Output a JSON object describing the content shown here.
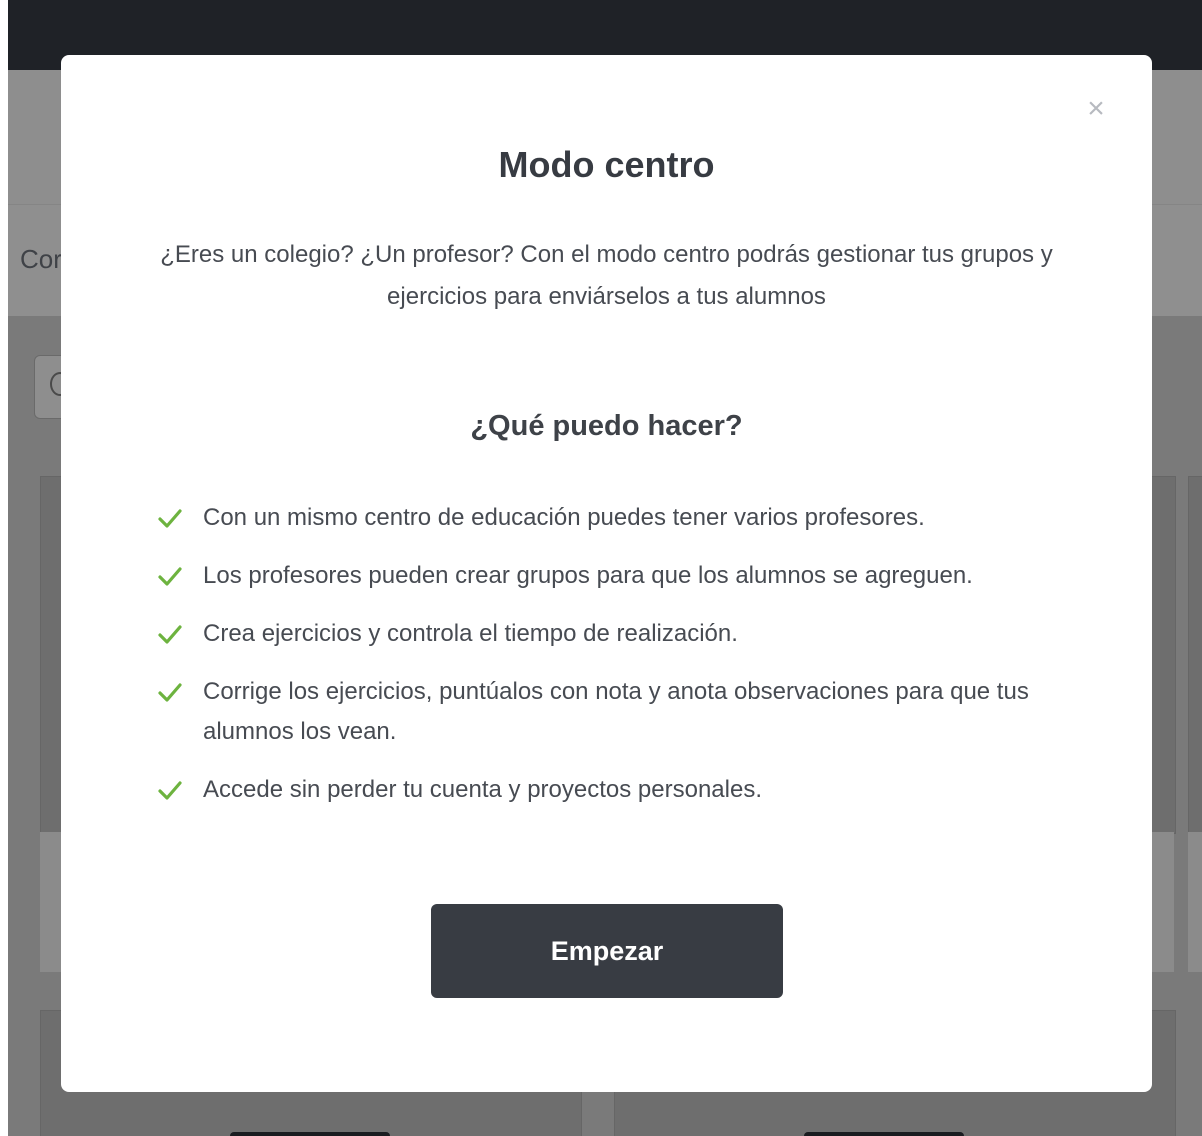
{
  "background": {
    "subheader_text": "Cor"
  },
  "modal": {
    "close_symbol": "×",
    "title": "Modo centro",
    "description": "¿Eres un colegio? ¿Un profesor? Con el modo centro podrás gestionar tus grupos y ejercicios para enviárselos a tus alumnos",
    "section_title": "¿Qué puedo hacer?",
    "features": [
      {
        "text": "Con un mismo centro de educación puedes tener varios profesores."
      },
      {
        "text": "Los profesores pueden crear grupos para que los alumnos se agreguen."
      },
      {
        "text": "Crea ejercicios y controla el tiempo de realización."
      },
      {
        "text": "Corrige los ejercicios, puntúalos con nota y anota observaciones para que tus alumnos los vean."
      },
      {
        "text": "Accede sin perder tu cuenta y proyectos personales."
      }
    ],
    "start_button": "Empezar"
  },
  "colors": {
    "check": "#6db33f",
    "button_bg": "#383c43",
    "overlay_dark": "#1f2227"
  },
  "icons": {
    "close": "close-icon",
    "check": "checkmark-icon",
    "search": "search-icon"
  }
}
